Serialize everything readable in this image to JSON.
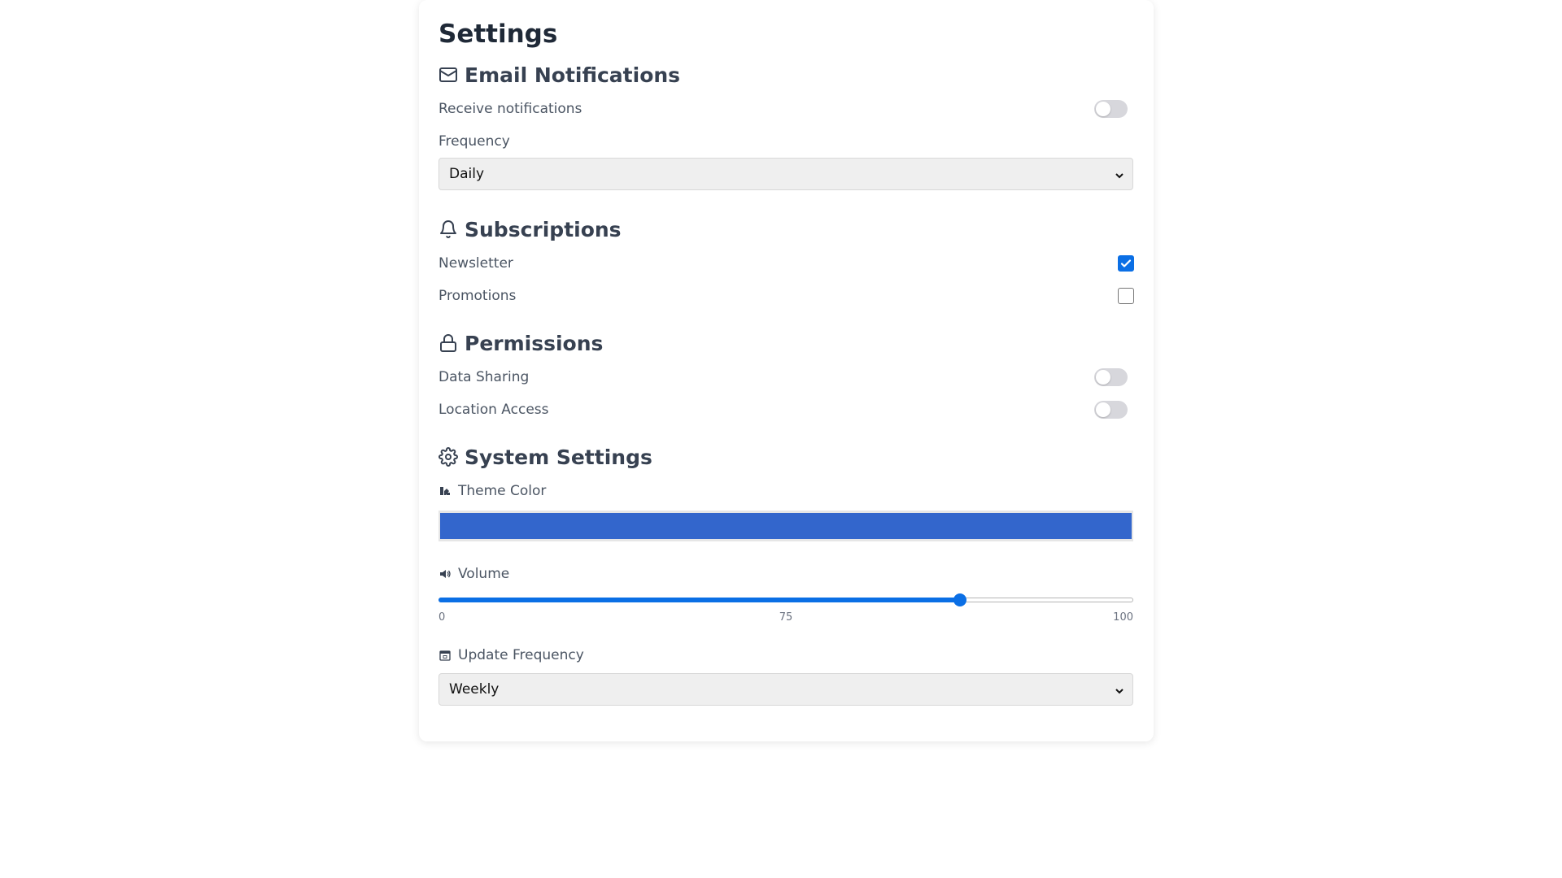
{
  "page": {
    "title": "Settings"
  },
  "sections": {
    "email": {
      "title": "Email Notifications",
      "icon": "envelope-icon",
      "receive_label": "Receive notifications",
      "receive_on": false,
      "frequency_label": "Frequency",
      "frequency_value": "Daily"
    },
    "subscriptions": {
      "title": "Subscriptions",
      "icon": "bell-icon",
      "newsletter_label": "Newsletter",
      "newsletter_checked": true,
      "promotions_label": "Promotions",
      "promotions_checked": false
    },
    "permissions": {
      "title": "Permissions",
      "icon": "lock-icon",
      "data_sharing_label": "Data Sharing",
      "data_sharing_on": false,
      "location_label": "Location Access",
      "location_on": false
    },
    "system": {
      "title": "System Settings",
      "icon": "gear-icon",
      "theme_label": "Theme Color",
      "theme_icon": "palette-icon",
      "theme_color": "#3366cc",
      "volume_label": "Volume",
      "volume_icon": "speaker-icon",
      "volume_min": "0",
      "volume_value": "75",
      "volume_max": "100",
      "update_label": "Update Frequency",
      "update_icon": "calendar-icon",
      "update_value": "Weekly"
    }
  },
  "colors": {
    "accent": "#0b6fe5",
    "toggle_off": "#d7d7dc"
  }
}
